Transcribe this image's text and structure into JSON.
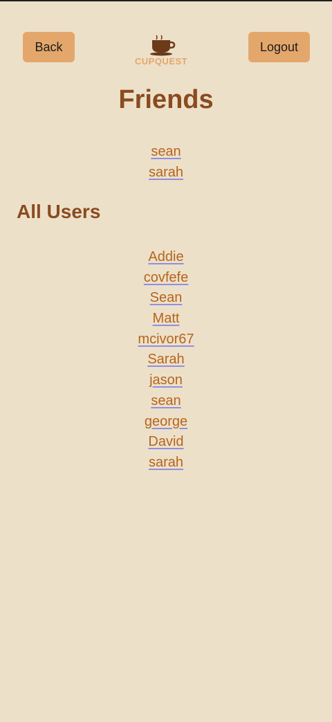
{
  "header": {
    "back_label": "Back",
    "logout_label": "Logout",
    "logo_text": "CUPQUEST"
  },
  "friends": {
    "title": "Friends",
    "items": [
      "sean",
      "sarah"
    ]
  },
  "all_users": {
    "title": "All Users",
    "items": [
      "Addie",
      "covfefe",
      "Sean",
      "Matt",
      "mcivor67",
      "Sarah",
      "jason",
      "sean",
      "george",
      "David",
      "sarah"
    ]
  },
  "colors": {
    "background": "#ede0c9",
    "button": "#e4a76b",
    "heading": "#8a4b20",
    "link": "#b5651d",
    "link_underline": "#8f8fe0"
  }
}
